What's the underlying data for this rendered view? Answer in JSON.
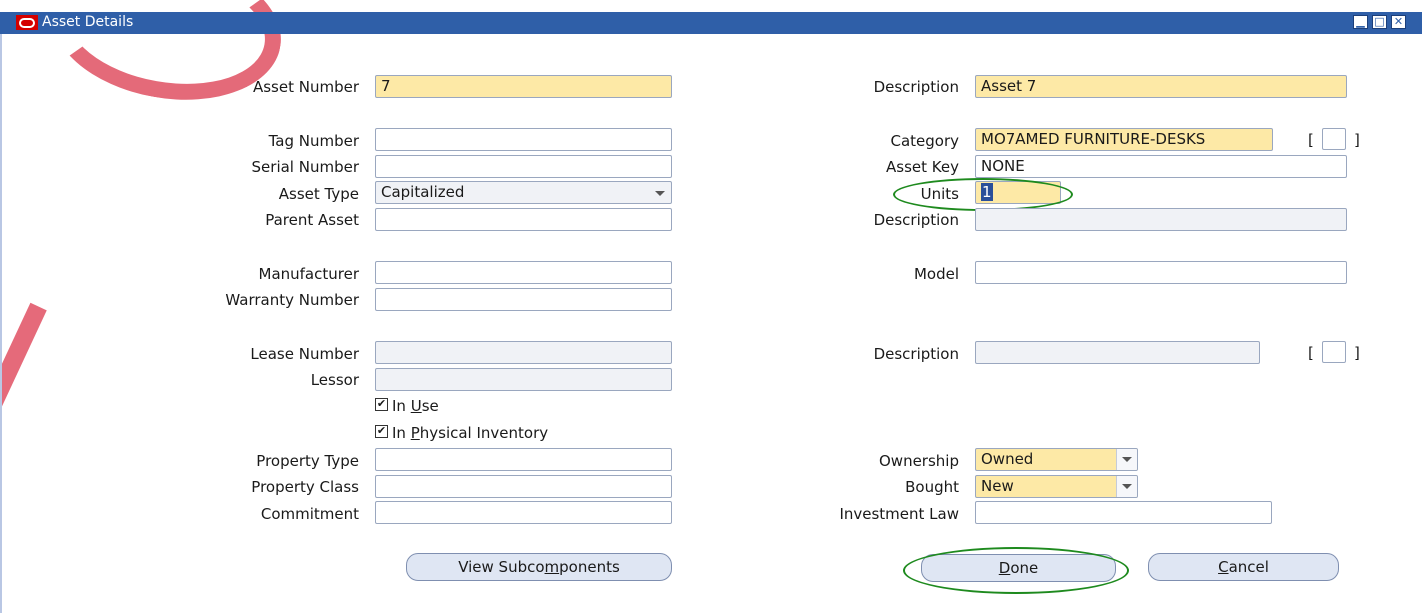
{
  "window": {
    "title": "Asset Details",
    "icon": "oracle-logo-icon",
    "controls": [
      "minimize-icon",
      "maximize-icon",
      "close-icon"
    ],
    "control_glyphs": {
      "minimize": "▁",
      "maximize": "□",
      "close": "✕"
    }
  },
  "left": {
    "asset_number": {
      "label": "Asset Number",
      "value": "7"
    },
    "tag_number": {
      "label": "Tag Number",
      "value": ""
    },
    "serial_number": {
      "label": "Serial Number",
      "value": ""
    },
    "asset_type": {
      "label": "Asset Type",
      "value": "Capitalized"
    },
    "parent_asset": {
      "label": "Parent Asset",
      "value": ""
    },
    "manufacturer": {
      "label": "Manufacturer",
      "value": ""
    },
    "warranty_number": {
      "label": "Warranty Number",
      "value": ""
    },
    "lease_number": {
      "label": "Lease Number",
      "value": ""
    },
    "lessor": {
      "label": "Lessor",
      "value": ""
    },
    "in_use": {
      "label_pre": "In ",
      "label_u": "U",
      "label_post": "se",
      "checked": true
    },
    "in_physical_inventory": {
      "label_pre": "In ",
      "label_u": "P",
      "label_post": "hysical Inventory",
      "checked": true
    },
    "property_type": {
      "label": "Property Type",
      "value": ""
    },
    "property_class": {
      "label": "Property Class",
      "value": ""
    },
    "commitment": {
      "label": "Commitment",
      "value": ""
    }
  },
  "right": {
    "description": {
      "label": "Description",
      "value": "Asset 7"
    },
    "category": {
      "label": "Category",
      "value": "MO7AMED FURNITURE-DESKS"
    },
    "asset_key": {
      "label": "Asset Key",
      "value": "NONE"
    },
    "units": {
      "label": "Units",
      "value": "1"
    },
    "category_description": {
      "label": "Description",
      "value": ""
    },
    "model": {
      "label": "Model",
      "value": ""
    },
    "lease_description": {
      "label": "Description",
      "value": ""
    },
    "ownership": {
      "label": "Ownership",
      "value": "Owned"
    },
    "bought": {
      "label": "Bought",
      "value": "New"
    },
    "investment_law": {
      "label": "Investment Law",
      "value": ""
    }
  },
  "flex_bracket": {
    "open": "[",
    "close": "]"
  },
  "buttons": {
    "view_subcomponents": {
      "pre": "View Subco",
      "u": "m",
      "post": "ponents"
    },
    "done": {
      "pre": "",
      "u": "D",
      "post": "one"
    },
    "cancel": {
      "pre": "",
      "u": "C",
      "post": "ancel"
    }
  },
  "colors": {
    "title_bar": "#2f5fa8",
    "required_field": "#fde9a6",
    "annotation": "#1e8a1e",
    "button": "#dfe6f3"
  }
}
